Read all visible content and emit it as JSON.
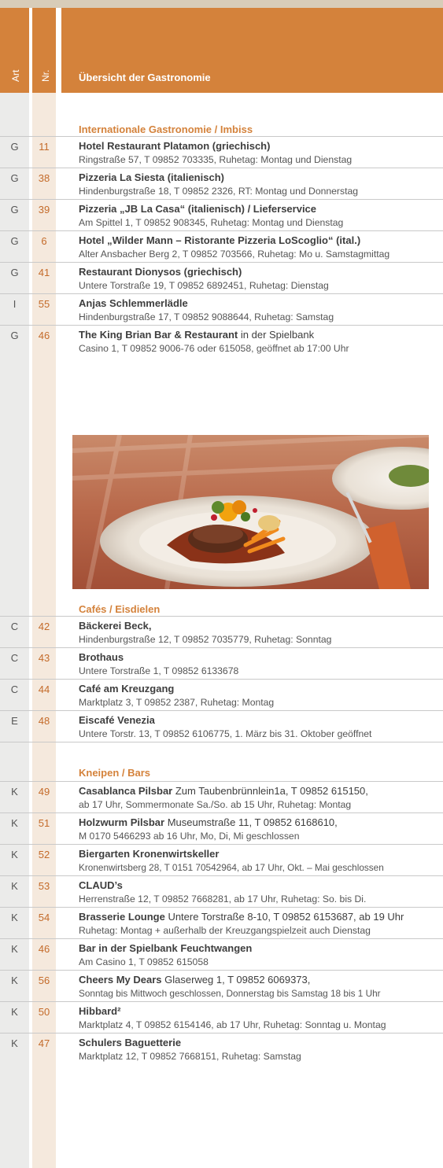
{
  "header": {
    "col_art": "Art",
    "col_nr": "Nr.",
    "title": "Übersicht der Gastronomie"
  },
  "sections": {
    "international": "Internationale Gastronomie / Imbiss",
    "cafes": "Cafés / Eisdielen",
    "kneipen": "Kneipen / Bars"
  },
  "entries": [
    {
      "art": "G",
      "nr": "11",
      "name": "Hotel Restaurant Platamon (griechisch)",
      "extra": "",
      "d1": "Ringstraße 57, T 09852 703335, Ruhetag: Montag und Dienstag",
      "d2": ""
    },
    {
      "art": "G",
      "nr": "38",
      "name": "Pizzeria La Siesta (italienisch)",
      "extra": "",
      "d1": "Hindenburgstraße 18, T 09852 2326, RT: Montag und Donnerstag",
      "d2": ""
    },
    {
      "art": "G",
      "nr": "39",
      "name": "Pizzeria „JB La Casa“ (italienisch) / Lieferservice",
      "extra": "",
      "d1": "Am Spittel 1, T 09852 908345, Ruhetag: Montag und Dienstag",
      "d2": ""
    },
    {
      "art": "G",
      "nr": "6",
      "name": "Hotel „Wilder Mann – Ristorante Pizzeria LoScoglio“ (ital.)",
      "extra": "",
      "d1": "Alter Ansbacher Berg 2, T 09852 703566, Ruhetag: Mo u. Samstagmittag",
      "d2": ""
    },
    {
      "art": "G",
      "nr": "41",
      "name": "Restaurant Dionysos (griechisch)",
      "extra": "",
      "d1": "Untere Torstraße 19, T 09852 6892451, Ruhetag: Dienstag",
      "d2": ""
    },
    {
      "art": "I",
      "nr": "55",
      "name": "Anjas Schlemmerlädle",
      "extra": "",
      "d1": "Hindenburgstraße 17, T 09852 9088644, Ruhetag: Samstag",
      "d2": ""
    },
    {
      "art": "G",
      "nr": "46",
      "name": "The King Brian Bar & Restaurant",
      "extra": " in der Spielbank",
      "d1": "Casino 1, T 09852 9006-76 oder 615058, geöffnet ab 17:00 Uhr",
      "d2": ""
    },
    {
      "art": "C",
      "nr": "42",
      "name": "Bäckerei Beck,",
      "extra": "",
      "d1": "Hindenburgstraße 12, T 09852 7035779, Ruhetag: Sonntag",
      "d2": ""
    },
    {
      "art": "C",
      "nr": "43",
      "name": "Brothaus",
      "extra": "",
      "d1": "Untere Torstraße 1, T 09852 6133678",
      "d2": ""
    },
    {
      "art": "C",
      "nr": "44",
      "name": "Café am Kreuzgang",
      "extra": "",
      "d1": "Marktplatz 3, T 09852 2387, Ruhetag: Montag",
      "d2": ""
    },
    {
      "art": "E",
      "nr": "48",
      "name": "Eiscafé Venezia",
      "extra": "",
      "d1": "Untere Torstr. 13, T 09852 6106775, 1. März bis 31. Oktober geöffnet",
      "d2": ""
    },
    {
      "art": "K",
      "nr": "49",
      "name": "Casablanca Pilsbar",
      "extra": " Zum Taubenbrünnlein1a, T 09852 615150,",
      "d1": "ab 17 Uhr, Sommermonate Sa./So. ab 15 Uhr, Ruhetag: Montag",
      "d2": ""
    },
    {
      "art": "K",
      "nr": "51",
      "name": "Holzwurm Pilsbar",
      "extra": " Museumstraße 11, T 09852 6168610,",
      "d1": "M 0170 5466293 ab 16 Uhr, Mo, Di, Mi geschlossen",
      "d2": ""
    },
    {
      "art": "K",
      "nr": "52",
      "name": "Biergarten Kronenwirtskeller",
      "extra": "",
      "d1": "Kronenwirtsberg 28, T 0151 70542964, ab 17 Uhr, Okt. – Mai geschlossen",
      "d2": ""
    },
    {
      "art": "K",
      "nr": "53",
      "name": "CLAUD’s",
      "extra": "",
      "d1": "Herrenstraße 12, T 09852 7668281, ab 17 Uhr,  Ruhetag: So. bis Di.",
      "d2": ""
    },
    {
      "art": "K",
      "nr": "54",
      "name": "Brasserie Lounge",
      "extra": " Untere Torstraße 8-10, T 09852 6153687, ab 19 Uhr",
      "d1": "Ruhetag: Montag + außerhalb der Kreuzgangspielzeit auch Dienstag",
      "d2": ""
    },
    {
      "art": "K",
      "nr": "46",
      "name": "Bar in der Spielbank Feuchtwangen",
      "extra": "",
      "d1": "Am Casino 1, T 09852 615058",
      "d2": ""
    },
    {
      "art": "K",
      "nr": "56",
      "name": "Cheers My Dears",
      "extra": " Glaserweg 1, T 09852 6069373,",
      "d1": "Sonntag bis Mittwoch geschlossen, Donnerstag bis Samstag 18 bis 1 Uhr",
      "d2": ""
    },
    {
      "art": "K",
      "nr": "50",
      "name": "Hibbard²",
      "extra": "",
      "d1": "Marktplatz 4, T 09852 6154146, ab 17 Uhr, Ruhetag: Sonntag u. Montag",
      "d2": ""
    },
    {
      "art": "K",
      "nr": "47",
      "name": "Schulers Baguetterie",
      "extra": "",
      "d1": "Marktplatz 12, T 09852 7668151, Ruhetag: Samstag",
      "d2": ""
    }
  ],
  "colors": {
    "accent": "#d4823b",
    "art_column": "#ebebea",
    "nr_column": "#f5e9dd",
    "nr_text": "#c46b2a"
  }
}
